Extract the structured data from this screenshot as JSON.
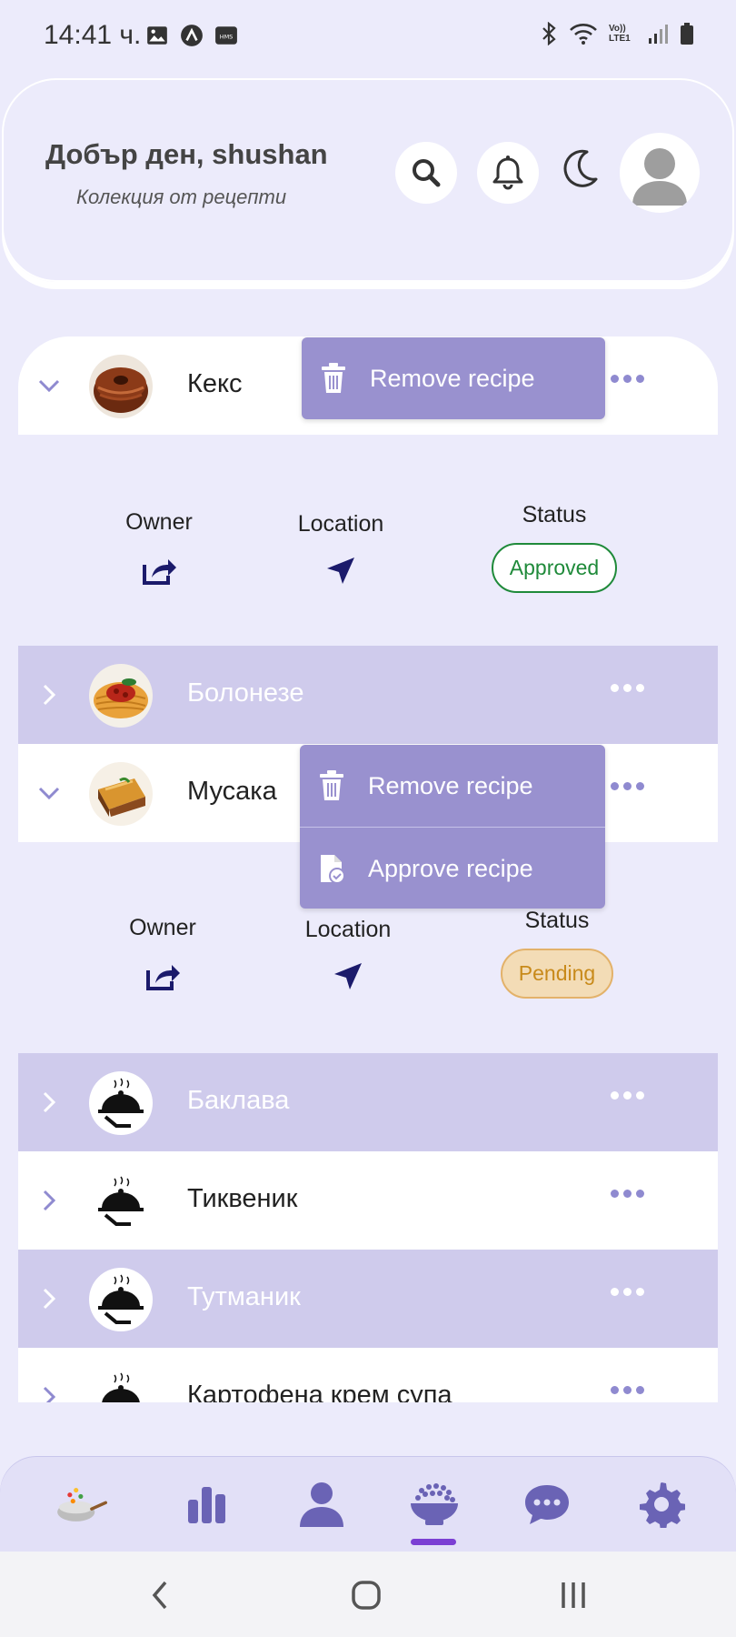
{
  "status_bar": {
    "time": "14:41 ч.",
    "left_icons": [
      "gallery-icon",
      "app-icon",
      "hms-icon"
    ],
    "right_icons": [
      "bluetooth-icon",
      "wifi-icon",
      "volte-icon",
      "signal-icon",
      "battery-icon"
    ],
    "volte_text": "Vo)) LTE1"
  },
  "header": {
    "greeting": "Добър ден, shushan",
    "subtitle": "Колекция от рецепти"
  },
  "recipes": [
    {
      "name": "Кекс",
      "expanded": true,
      "thumb": "cake-icon"
    },
    {
      "name": "Болонезе",
      "expanded": false,
      "thumb": "spaghetti-icon"
    },
    {
      "name": "Мусака",
      "expanded": true,
      "thumb": "moussaka-icon"
    },
    {
      "name": "Баклава",
      "expanded": false,
      "thumb": "cloche-icon"
    },
    {
      "name": "Тиквеник",
      "expanded": false,
      "thumb": "cloche-icon"
    },
    {
      "name": "Тутманик",
      "expanded": false,
      "thumb": "cloche-icon"
    },
    {
      "name": "Картофена крем супа",
      "expanded": false,
      "thumb": "cloche-icon"
    }
  ],
  "details": {
    "owner_label": "Owner",
    "location_label": "Location",
    "status_label": "Status",
    "keks_status": "Approved",
    "musaka_status": "Pending"
  },
  "menus": {
    "remove_label": "Remove recipe",
    "approve_label": "Approve recipe"
  },
  "colors": {
    "accent": "#9991cf",
    "row_alt": "#cfcbec",
    "icon_dark": "#1b1a6b",
    "nav_icon": "#6a63b5",
    "active_indicator": "#7b3fd3"
  },
  "navbar": {
    "items": [
      "wok-icon",
      "chart-icon",
      "user-icon",
      "bowl-icon",
      "chat-icon",
      "settings-icon"
    ],
    "active": "bowl-icon"
  }
}
